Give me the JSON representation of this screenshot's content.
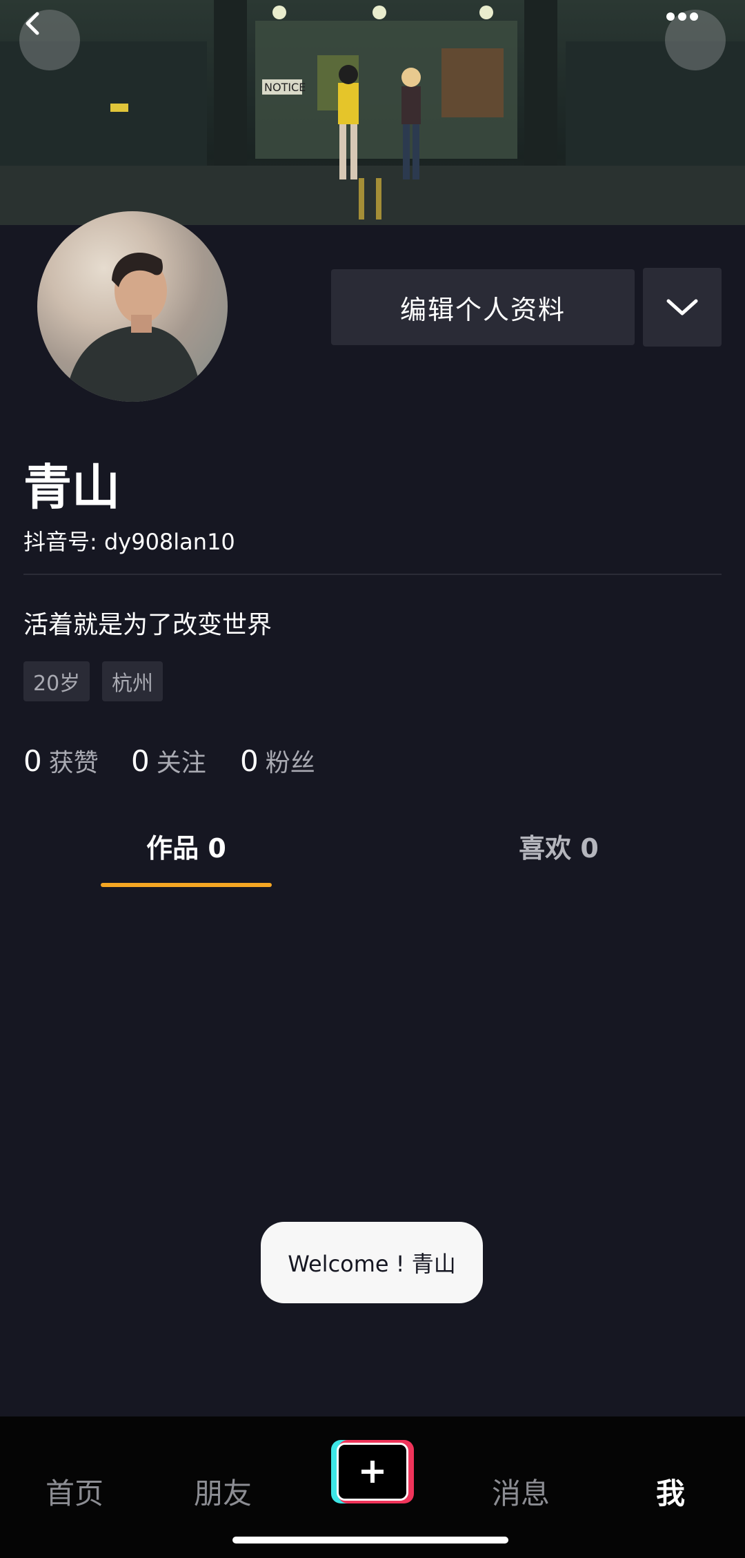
{
  "cover": {
    "sign_text": "NOTICE"
  },
  "profile": {
    "edit_label": "编辑个人资料",
    "name": "青山",
    "douyin_id": "抖音号: dy908lan10",
    "bio": "活着就是为了改变世界",
    "tags": [
      "20岁",
      "杭州"
    ]
  },
  "stats": [
    {
      "value": "0",
      "label": "获赞"
    },
    {
      "value": "0",
      "label": "关注"
    },
    {
      "value": "0",
      "label": "粉丝"
    }
  ],
  "tabs": [
    {
      "label": "作品 0",
      "active": true
    },
    {
      "label": "喜欢 0",
      "active": false
    }
  ],
  "toast": {
    "text": "Welcome ! 青山"
  },
  "bottom_nav": {
    "items": [
      {
        "label": "首页",
        "active": false
      },
      {
        "label": "朋友",
        "active": false
      },
      {
        "label": "消息",
        "active": false
      },
      {
        "label": "我",
        "active": true
      }
    ]
  },
  "colors": {
    "background": "#161722",
    "tab_indicator": "#f5a623",
    "button_bg": "#2a2b36",
    "create_cyan": "#3ee6e6",
    "create_pink": "#f0345a"
  }
}
